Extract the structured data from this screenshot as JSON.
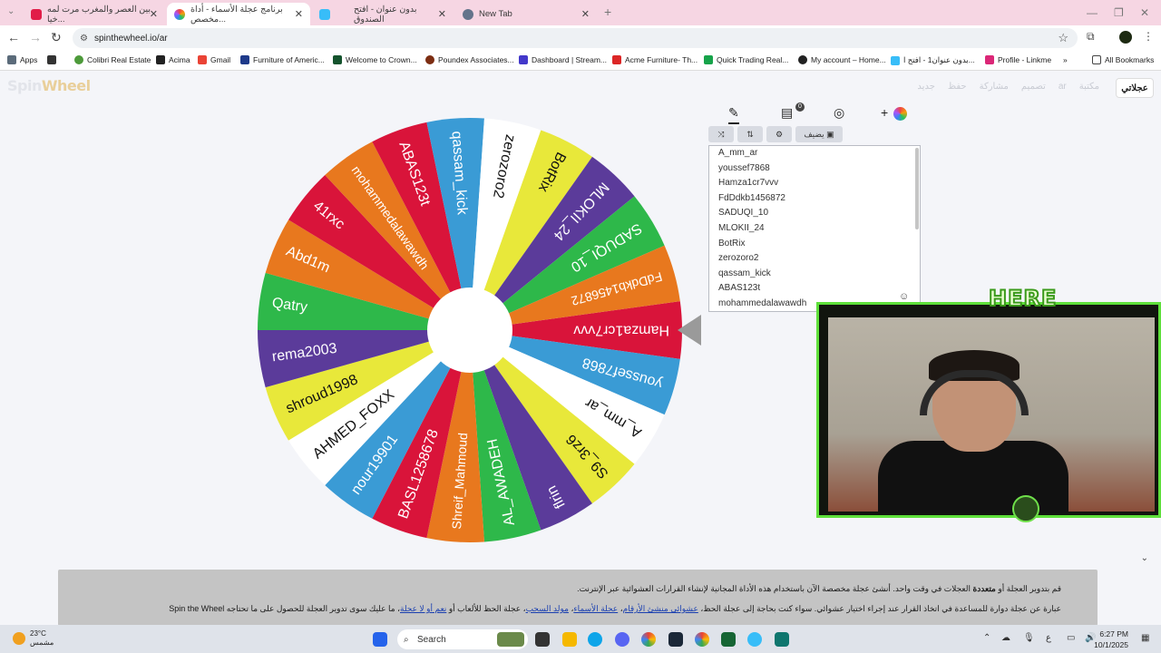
{
  "browser": {
    "tabs": [
      {
        "title": "بين العصر والمغرب مرت لمه خيا...",
        "favicon_color": "#e11d48"
      },
      {
        "title": "برنامج عجلة الأسماء - أداة مخصص...",
        "favicon_color": "#f59e0b"
      },
      {
        "title": "بدون عنوان - افتح الصندوق",
        "favicon_color": "#38bdf8"
      },
      {
        "title": "New Tab",
        "favicon_color": "#64748b"
      }
    ],
    "url": "spinthewheel.io/ar",
    "bookmarks": [
      "Apps",
      "Colibri Real Estate",
      "Acima",
      "Gmail",
      "Furniture of Americ...",
      "Welcome to Crown...",
      "Poundex Associates...",
      "Dashboard | Stream...",
      "Acme Furniture- Th...",
      "Quick Trading Real...",
      "My account – Home...",
      "بدون عنوان1 - افتح ا...",
      "Profile - Linkme",
      "All Bookmarks"
    ]
  },
  "site": {
    "logo_a": "Spin",
    "logo_b": "Wheel",
    "nav": [
      "جديد",
      "حفظ",
      "مشاركة",
      "تصميم",
      "ar",
      "مكتبة"
    ],
    "cta": "عجلاتي"
  },
  "wheel": {
    "pointer_color": "#9a9a9a",
    "segments": [
      {
        "name": "Hamza1cr7vvv",
        "color": "#d9143a"
      },
      {
        "name": "youssef7868",
        "color": "#3a9bd5"
      },
      {
        "name": "A_mm_ar",
        "color": "#ffffff"
      },
      {
        "name": "S9_3rz6",
        "color": "#e8e83a"
      },
      {
        "name": "flrin",
        "color": "#5b3b9a"
      },
      {
        "name": "AL_AWADEH",
        "color": "#2eb84a"
      },
      {
        "name": "Shreif_Mahmoud",
        "color": "#e8781e"
      },
      {
        "name": "BASL1258678",
        "color": "#d9143a"
      },
      {
        "name": "nour19901",
        "color": "#3a9bd5"
      },
      {
        "name": "AHMED_FOXX",
        "color": "#ffffff"
      },
      {
        "name": "shroud1998",
        "color": "#e8e83a"
      },
      {
        "name": "rema2003",
        "color": "#5b3b9a"
      },
      {
        "name": "Qatry",
        "color": "#2eb84a"
      },
      {
        "name": "Abd1m",
        "color": "#e8781e"
      },
      {
        "name": "41rxc",
        "color": "#d9143a"
      },
      {
        "name": "mohammedalawawdh",
        "color": "#e8781e"
      },
      {
        "name": "ABAS123t",
        "color": "#d9143a"
      },
      {
        "name": "qassam_kick",
        "color": "#3a9bd5"
      },
      {
        "name": "zerozoro2",
        "color": "#ffffff"
      },
      {
        "name": "BotRix",
        "color": "#e8e83a"
      },
      {
        "name": "MLOKII_24",
        "color": "#5b3b9a"
      },
      {
        "name": "SADUQI_10",
        "color": "#2eb84a"
      },
      {
        "name": "FdDdkb1456872",
        "color": "#e8781e"
      }
    ]
  },
  "controls": {
    "add_label": "يضيف",
    "badge": "0",
    "entries": [
      "A_mm_ar",
      "youssef7868",
      "Hamza1cr7vvv",
      "FdDdkb1456872",
      "SADUQI_10",
      "MLOKII_24",
      "BotRix",
      "zerozoro2",
      "qassam_kick",
      "ABAS123t",
      "mohammedalawawdh"
    ]
  },
  "overlay": {
    "here": "HERE"
  },
  "info": {
    "line1_a": "قم بتدوير العجلة أو",
    "line1_b": "متعددة",
    "line1_c": "العجلات في وقت واحد. أنشئ عجلة مخصصة الآن باستخدام هذه الأداة المجانية لإنشاء القرارات العشوائية عبر الإنترنت.",
    "line2_a": "عبارة عن عجلة دوارة للمساعدة في اتخاذ القرار عند إجراء اختيار عشوائي. سواء كنت بحاجة إلى عجلة الحظ،",
    "link1": "عشوائي منشئ الأرقام",
    "link2": "عجلة الأسماء",
    "link3": "مولد السحب",
    "line2_b": "عجلة الحظ للألعاب أو",
    "link4": "نعم أو لا عجلة",
    "line2_c": "ما عليك سوى تدوير العجلة للحصول على ما تحتاجه",
    "brand": "Spin the Wheel"
  },
  "taskbar": {
    "temp": "23°C",
    "weather": "مشمس",
    "search": "Search",
    "time": "6:27 PM",
    "date": "10/1/2025",
    "lang": "ع"
  }
}
